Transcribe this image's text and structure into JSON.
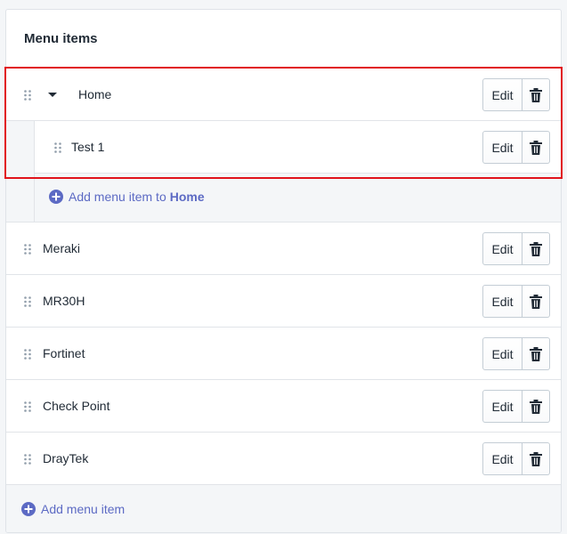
{
  "card": {
    "title": "Menu items"
  },
  "items": {
    "home": {
      "label": "Home",
      "edit_label": "Edit"
    },
    "test1": {
      "label": "Test 1",
      "edit_label": "Edit"
    },
    "meraki": {
      "label": "Meraki",
      "edit_label": "Edit"
    },
    "mr30h": {
      "label": "MR30H",
      "edit_label": "Edit"
    },
    "fortinet": {
      "label": "Fortinet",
      "edit_label": "Edit"
    },
    "checkpoint": {
      "label": "Check Point",
      "edit_label": "Edit"
    },
    "draytek": {
      "label": "DrayTek",
      "edit_label": "Edit"
    }
  },
  "nested_add": {
    "prefix": "Add menu item to",
    "target": "Home"
  },
  "bottom_add": {
    "label": "Add menu item"
  },
  "icons": {
    "drag": "drag-handle-icon",
    "caret": "caret-down-icon",
    "delete": "trash-icon",
    "add": "plus-circle-icon"
  },
  "colors": {
    "link": "#5c6ac4",
    "highlight": "#e1131b",
    "border": "#c4cdd5",
    "subdued_bg": "#f4f6f8"
  }
}
